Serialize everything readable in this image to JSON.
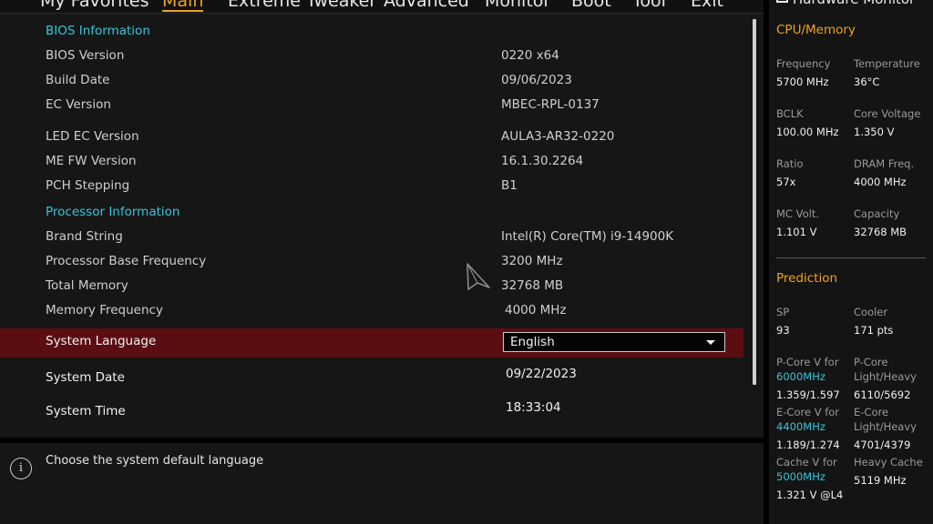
{
  "nav": {
    "items": [
      {
        "label": "My Favorites"
      },
      {
        "label": "Main"
      },
      {
        "label": "Extreme Tweaker"
      },
      {
        "label": "Advanced"
      },
      {
        "label": "Monitor"
      },
      {
        "label": "Boot"
      },
      {
        "label": "Tool"
      },
      {
        "label": "Exit"
      }
    ],
    "active": "Main"
  },
  "main": {
    "bios_info_title": "BIOS Information",
    "rows": [
      {
        "label": "BIOS Version",
        "value": "0220  x64"
      },
      {
        "label": "Build Date",
        "value": "09/06/2023"
      },
      {
        "label": "EC Version",
        "value": "MBEC-RPL-0137"
      },
      {
        "label": "LED EC Version",
        "value": "AULA3-AR32-0220"
      },
      {
        "label": "ME FW Version",
        "value": "16.1.30.2264"
      },
      {
        "label": "PCH Stepping",
        "value": "B1"
      }
    ],
    "processor_info_title": "Processor Information",
    "proc_rows": [
      {
        "label": "Brand String",
        "value": "Intel(R) Core(TM) i9-14900K"
      },
      {
        "label": "Processor Base Frequency",
        "value": "3200 MHz"
      },
      {
        "label": "Total Memory",
        "value": "32768 MB"
      },
      {
        "label": "Memory Frequency",
        "value": "4000 MHz"
      }
    ],
    "system_language": {
      "label": "System Language",
      "value": "English"
    },
    "system_date": {
      "label": "System Date",
      "value": "09/22/2023"
    },
    "system_time": {
      "label": "System Time",
      "value": "18:33:04"
    }
  },
  "help": {
    "text": "Choose the system default language"
  },
  "hw_monitor": {
    "title": "Hardware Monitor",
    "cpu_memory_title": "CPU/Memory",
    "cpu": [
      {
        "label": "Frequency",
        "value": "5700 MHz"
      },
      {
        "label": "Temperature",
        "value": "36°C"
      },
      {
        "label": "BCLK",
        "value": "100.00 MHz"
      },
      {
        "label": "Core Voltage",
        "value": "1.350 V"
      },
      {
        "label": "Ratio",
        "value": "57x"
      },
      {
        "label": "DRAM Freq.",
        "value": "4000 MHz"
      },
      {
        "label": "MC Volt.",
        "value": "1.101 V"
      },
      {
        "label": "Capacity",
        "value": "32768 MB"
      }
    ],
    "prediction_title": "Prediction",
    "sp": {
      "label": "SP",
      "value": "93"
    },
    "cooler": {
      "label": "Cooler",
      "value": "171 pts"
    },
    "pcore_v": {
      "line1": "P-Core V for",
      "freq": "6000MHz",
      "value": "1.359/1.597"
    },
    "pcore_lh": {
      "line1": "P-Core",
      "line2": "Light/Heavy",
      "value": "6110/5692"
    },
    "ecore_v": {
      "line1": "E-Core V for",
      "freq": "4400MHz",
      "value": "1.189/1.274"
    },
    "ecore_lh": {
      "line1": "E-Core",
      "line2": "Light/Heavy",
      "value": "4701/4379"
    },
    "cache_v": {
      "line1": "Cache V for",
      "freq": "5000MHz",
      "value": "1.321 V @L4"
    },
    "heavy_cache": {
      "line1": "Heavy Cache",
      "value": "5119 MHz"
    }
  }
}
